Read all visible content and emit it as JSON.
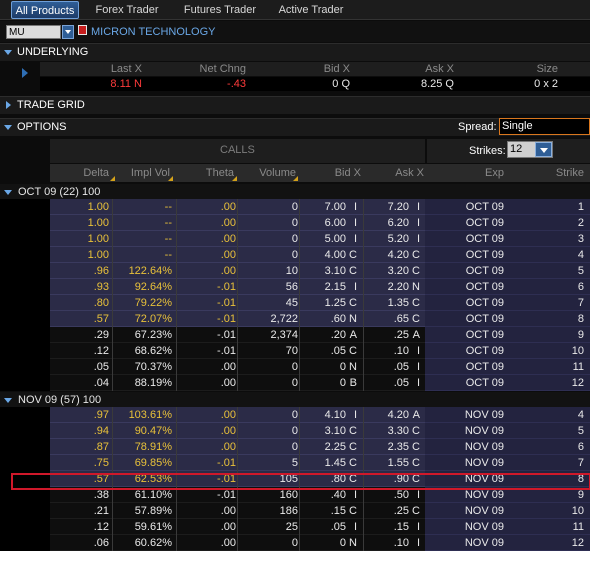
{
  "tabs": [
    "All Products",
    "Forex Trader",
    "Futures Trader",
    "Active Trader"
  ],
  "symbol": {
    "value": "MU",
    "name": "MICRON TECHNOLOGY"
  },
  "sections": {
    "underlying": "UNDERLYING",
    "trade_grid": "TRADE GRID",
    "options": "OPTIONS"
  },
  "underlying": {
    "headers": [
      "Last X",
      "Net Chng",
      "Bid X",
      "Ask X",
      "Size"
    ],
    "values": [
      "8.11 N",
      "-.43",
      "0 Q",
      "8.25 Q",
      "0 x 2"
    ]
  },
  "options": {
    "spread_label": "Spread:",
    "spread_value": "Single",
    "calls_label": "CALLS",
    "strikes_label": "Strikes:",
    "strikes_value": "12",
    "columns": [
      "Delta",
      "Impl Vol",
      "Theta",
      "Volume",
      "Bid X",
      "Ask X",
      "Exp",
      "Strike"
    ]
  },
  "groups": [
    {
      "label": "OCT 09   (22)  100",
      "rows": [
        {
          "delta": "1.00",
          "iv": "--",
          "theta": ".00",
          "vol": "0",
          "bid": "7.00",
          "bx": "I",
          "ask": "7.20",
          "ax": "I",
          "exp": "OCT 09",
          "strike": "1",
          "itm": true
        },
        {
          "delta": "1.00",
          "iv": "--",
          "theta": ".00",
          "vol": "0",
          "bid": "6.00",
          "bx": "I",
          "ask": "6.20",
          "ax": "I",
          "exp": "OCT 09",
          "strike": "2",
          "itm": true
        },
        {
          "delta": "1.00",
          "iv": "--",
          "theta": ".00",
          "vol": "0",
          "bid": "5.00",
          "bx": "I",
          "ask": "5.20",
          "ax": "I",
          "exp": "OCT 09",
          "strike": "3",
          "itm": true
        },
        {
          "delta": "1.00",
          "iv": "--",
          "theta": ".00",
          "vol": "0",
          "bid": "4.00",
          "bx": "C",
          "ask": "4.20",
          "ax": "C",
          "exp": "OCT 09",
          "strike": "4",
          "itm": true
        },
        {
          "delta": ".96",
          "iv": "122.64%",
          "theta": ".00",
          "vol": "10",
          "bid": "3.10",
          "bx": "C",
          "ask": "3.20",
          "ax": "C",
          "exp": "OCT 09",
          "strike": "5",
          "itm": true
        },
        {
          "delta": ".93",
          "iv": "92.64%",
          "theta": "-.01",
          "vol": "56",
          "bid": "2.15",
          "bx": "I",
          "ask": "2.20",
          "ax": "N",
          "exp": "OCT 09",
          "strike": "6",
          "itm": true
        },
        {
          "delta": ".80",
          "iv": "79.22%",
          "theta": "-.01",
          "vol": "45",
          "bid": "1.25",
          "bx": "C",
          "ask": "1.35",
          "ax": "C",
          "exp": "OCT 09",
          "strike": "7",
          "itm": true
        },
        {
          "delta": ".57",
          "iv": "72.07%",
          "theta": "-.01",
          "vol": "2,722",
          "bid": ".60",
          "bx": "N",
          "ask": ".65",
          "ax": "C",
          "exp": "OCT 09",
          "strike": "8",
          "itm": true
        },
        {
          "delta": ".29",
          "iv": "67.23%",
          "theta": "-.01",
          "vol": "2,374",
          "bid": ".20",
          "bx": "A",
          "ask": ".25",
          "ax": "A",
          "exp": "OCT 09",
          "strike": "9",
          "itm": false
        },
        {
          "delta": ".12",
          "iv": "68.62%",
          "theta": "-.01",
          "vol": "70",
          "bid": ".05",
          "bx": "C",
          "ask": ".10",
          "ax": "I",
          "exp": "OCT 09",
          "strike": "10",
          "itm": false
        },
        {
          "delta": ".05",
          "iv": "70.37%",
          "theta": ".00",
          "vol": "0",
          "bid": "0",
          "bx": "N",
          "ask": ".05",
          "ax": "I",
          "exp": "OCT 09",
          "strike": "11",
          "itm": false
        },
        {
          "delta": ".04",
          "iv": "88.19%",
          "theta": ".00",
          "vol": "0",
          "bid": "0",
          "bx": "B",
          "ask": ".05",
          "ax": "I",
          "exp": "OCT 09",
          "strike": "12",
          "itm": false
        }
      ]
    },
    {
      "label": "NOV 09   (57)  100",
      "rows": [
        {
          "delta": ".97",
          "iv": "103.61%",
          "theta": ".00",
          "vol": "0",
          "bid": "4.10",
          "bx": "I",
          "ask": "4.20",
          "ax": "A",
          "exp": "NOV 09",
          "strike": "4",
          "itm": true
        },
        {
          "delta": ".94",
          "iv": "90.47%",
          "theta": ".00",
          "vol": "0",
          "bid": "3.10",
          "bx": "C",
          "ask": "3.30",
          "ax": "C",
          "exp": "NOV 09",
          "strike": "5",
          "itm": true
        },
        {
          "delta": ".87",
          "iv": "78.91%",
          "theta": ".00",
          "vol": "0",
          "bid": "2.25",
          "bx": "C",
          "ask": "2.35",
          "ax": "C",
          "exp": "NOV 09",
          "strike": "6",
          "itm": true
        },
        {
          "delta": ".75",
          "iv": "69.85%",
          "theta": "-.01",
          "vol": "5",
          "bid": "1.45",
          "bx": "C",
          "ask": "1.55",
          "ax": "C",
          "exp": "NOV 09",
          "strike": "7",
          "itm": true
        },
        {
          "delta": ".57",
          "iv": "62.53%",
          "theta": "-.01",
          "vol": "105",
          "bid": ".80",
          "bx": "C",
          "ask": ".90",
          "ax": "C",
          "exp": "NOV 09",
          "strike": "8",
          "itm": true
        },
        {
          "delta": ".38",
          "iv": "61.10%",
          "theta": "-.01",
          "vol": "160",
          "bid": ".40",
          "bx": "I",
          "ask": ".50",
          "ax": "I",
          "exp": "NOV 09",
          "strike": "9",
          "itm": false
        },
        {
          "delta": ".21",
          "iv": "57.89%",
          "theta": ".00",
          "vol": "186",
          "bid": ".15",
          "bx": "C",
          "ask": ".25",
          "ax": "C",
          "exp": "NOV 09",
          "strike": "10",
          "itm": false
        },
        {
          "delta": ".12",
          "iv": "59.61%",
          "theta": ".00",
          "vol": "25",
          "bid": ".05",
          "bx": "I",
          "ask": ".15",
          "ax": "I",
          "exp": "NOV 09",
          "strike": "11",
          "itm": false
        },
        {
          "delta": ".06",
          "iv": "60.62%",
          "theta": ".00",
          "vol": "0",
          "bid": "0",
          "bx": "N",
          "ask": ".10",
          "ax": "I",
          "exp": "NOV 09",
          "strike": "12",
          "itm": false
        }
      ]
    }
  ],
  "highlight": {
    "group": 1,
    "row": 4
  },
  "colors": {
    "accent": "#2f5e96",
    "itm": "#e8c13a",
    "negative": "#ff3b3b",
    "highlight": "#d0182a"
  }
}
